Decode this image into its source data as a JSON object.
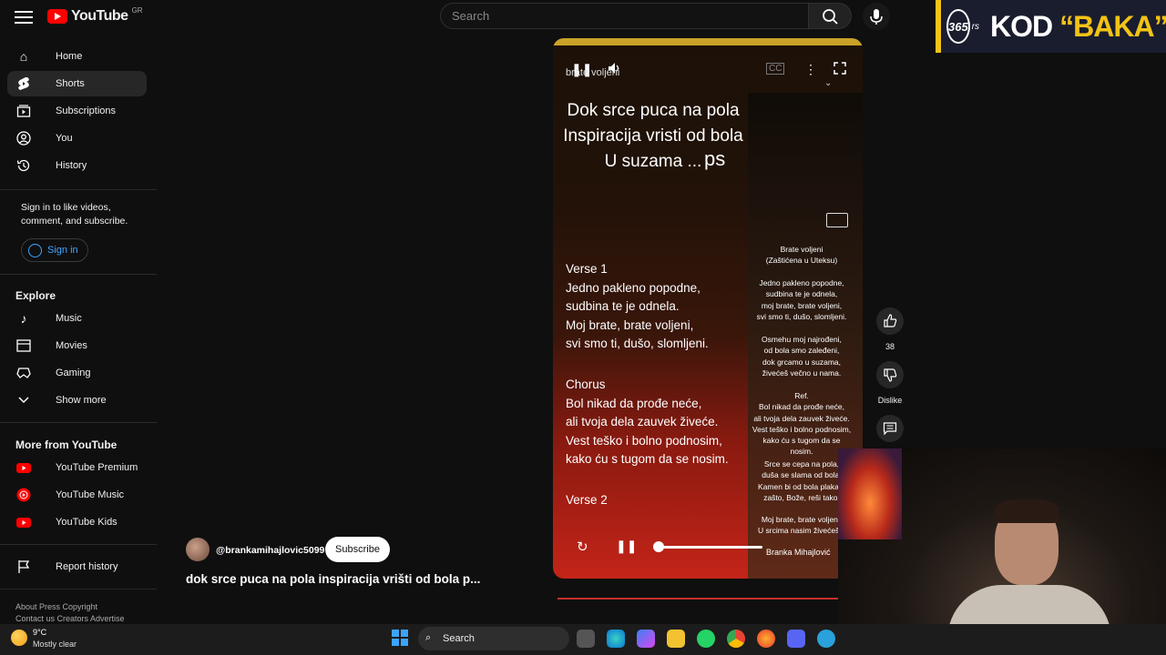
{
  "header": {
    "brand": "YouTube",
    "region": "GR",
    "search_placeholder": "Search"
  },
  "sidebar": {
    "items": [
      {
        "label": "Home",
        "icon": "home-icon"
      },
      {
        "label": "Shorts",
        "icon": "shorts-icon",
        "active": true
      },
      {
        "label": "Subscriptions",
        "icon": "subscriptions-icon"
      },
      {
        "label": "You",
        "icon": "you-icon"
      },
      {
        "label": "History",
        "icon": "history-icon"
      }
    ],
    "signin_prompt": "Sign in to like videos, comment, and subscribe.",
    "signin_label": "Sign in",
    "explore_title": "Explore",
    "explore": [
      {
        "label": "Music"
      },
      {
        "label": "Movies"
      },
      {
        "label": "Gaming"
      },
      {
        "label": "Show more"
      }
    ],
    "more_title": "More from YouTube",
    "more": [
      {
        "label": "YouTube Premium"
      },
      {
        "label": "YouTube Music"
      },
      {
        "label": "YouTube Kids"
      }
    ],
    "report": "Report history",
    "footer_line1": "About  Press  Copyright",
    "footer_line2": "Contact us  Creators  Advertise"
  },
  "short": {
    "handle": "brate voljeni",
    "header_lines": [
      "Dok srce puca na pola",
      "Inspiracija vristi od bola",
      "U suzama ..."
    ],
    "ps": "ps",
    "verse1_title": "Verse 1",
    "verse1": [
      "Jedno pakleno popodne,",
      "sudbina te je odnela.",
      "Moj brate, brate voljeni,",
      "svi smo ti, dušo, slomljeni."
    ],
    "chorus_title": "Chorus",
    "chorus": [
      "Bol nikad da prođe neće,",
      "ali tvoja dela zauvek živeće.",
      "Vest teško i bolno podnosim,",
      "kako ću s tugom da se nosim."
    ],
    "verse2_title": "Verse 2",
    "poster_title": "Brate voljeni",
    "poster_sub": "(Zaštićena u Uteksu)",
    "poster_lines1": [
      "Jedno pakleno popodne,",
      "sudbina te je odnela,",
      "moj brate, brate voljeni,",
      "svi smo ti, dušo, slomljeni."
    ],
    "poster_lines2": [
      "Osmehu moj najrođeni,",
      "od bola smo zaleđeni,",
      "dok grcamo u suzama,",
      "živećeš večno u nama."
    ],
    "poster_ref": "Ref.",
    "poster_lines3": [
      "Bol nikad da prođe neće,",
      "ali tvoja dela zauvek živeće.",
      "Vest teško i bolno podnosim,",
      "kako ću s tugom da se nosim."
    ],
    "poster_lines4": [
      "Srce se cepa na pola,",
      "duša se slama od bola.",
      "Kamen bi od bola plakao,",
      "zašto, Bože, reši tako."
    ],
    "poster_lines5": [
      "Moj brate, brate voljeni,",
      "U srcima nasim živećeš ti"
    ],
    "author": "Branka Mihajlović",
    "progress": 0.05
  },
  "actions": {
    "likes": "38",
    "dislike_label": "Dislike"
  },
  "channel": {
    "handle": "@brankamihajlovic5099",
    "subscribe_label": "Subscribe",
    "title": "dok srce puca na pola inspiracija vrišti od bola p..."
  },
  "overlay": {
    "logo_number": "365",
    "logo_suffix": "rs",
    "kod": "KOD",
    "baka": "“BAKA”"
  },
  "taskbar": {
    "temp": "9°C",
    "weather": "Mostly clear",
    "search": "Search"
  }
}
